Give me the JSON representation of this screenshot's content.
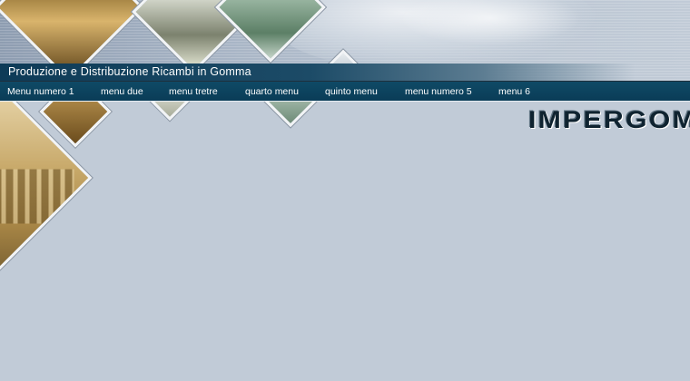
{
  "header": {
    "subtitle": "Produzione e Distribuzione Ricambi in Gomma"
  },
  "nav": {
    "items": [
      {
        "label": "Menu numero 1"
      },
      {
        "label": "menu due"
      },
      {
        "label": "menu tretre"
      },
      {
        "label": "quarto menu"
      },
      {
        "label": "quinto menu"
      },
      {
        "label": "menu numero 5"
      },
      {
        "label": "menu 6"
      }
    ]
  },
  "logo": {
    "text": "IMPERGOM"
  },
  "colors": {
    "background": "#c1cbd7",
    "nav_bar": "#0f4a66",
    "subtitle_bar": "#0e3b57",
    "nav_text": "#ffffff"
  }
}
